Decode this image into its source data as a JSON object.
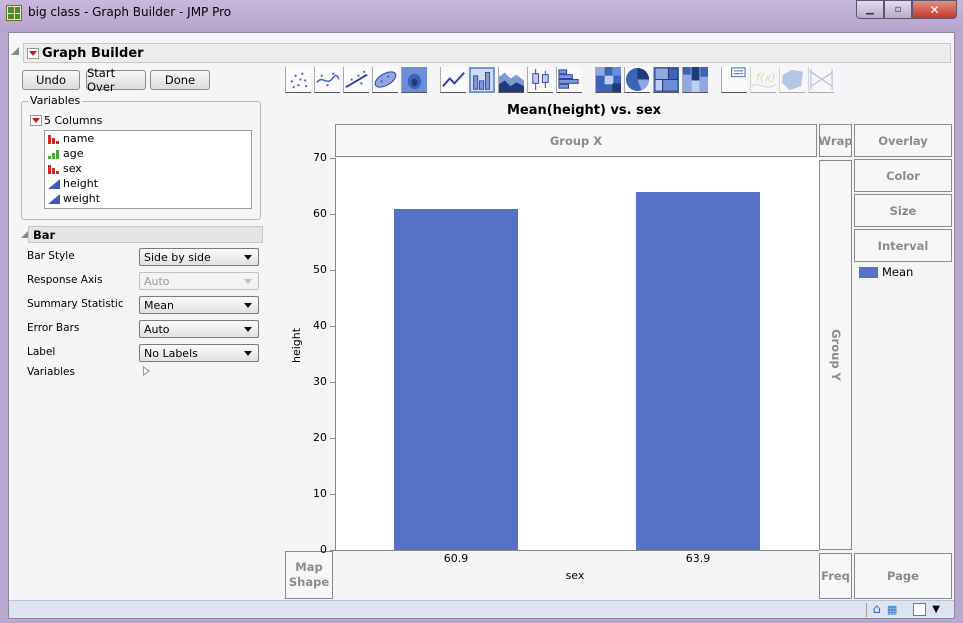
{
  "window": {
    "title": "big class - Graph Builder - JMP Pro",
    "controls": {
      "minimize": "minimize",
      "maximize": "maximize",
      "close": "close"
    }
  },
  "graph_builder": {
    "title": "Graph Builder",
    "buttons": {
      "undo": "Undo",
      "start_over": "Start Over",
      "done": "Done"
    }
  },
  "variables": {
    "legend": "Variables",
    "columns_label": "5 Columns",
    "columns": [
      {
        "name": "name",
        "type": "nominal",
        "icon": "nominal-icon"
      },
      {
        "name": "age",
        "type": "ordinal",
        "icon": "ordinal-icon"
      },
      {
        "name": "sex",
        "type": "nominal",
        "icon": "nominal-icon"
      },
      {
        "name": "height",
        "type": "continuous",
        "icon": "continuous-icon"
      },
      {
        "name": "weight",
        "type": "continuous",
        "icon": "continuous-icon"
      }
    ]
  },
  "bar_panel": {
    "title": "Bar",
    "properties": [
      {
        "label": "Bar Style",
        "value": "Side by side",
        "enabled": true
      },
      {
        "label": "Response Axis",
        "value": "Auto",
        "enabled": false
      },
      {
        "label": "Summary Statistic",
        "value": "Mean",
        "enabled": true
      },
      {
        "label": "Error Bars",
        "value": "Auto",
        "enabled": true
      },
      {
        "label": "Label",
        "value": "No Labels",
        "enabled": true
      }
    ],
    "variables_label": "Variables"
  },
  "toolbar": {
    "elements": [
      "points",
      "smoother",
      "line-of-fit",
      "ellipse",
      "contour",
      "line",
      "bar",
      "area",
      "box-plot",
      "histogram",
      "heatmap",
      "pie",
      "treemap",
      "mosaic",
      "caption-box",
      "formula",
      "map-shapes",
      "parallel"
    ],
    "active": "bar",
    "disabled": [
      "formula",
      "map-shapes",
      "parallel"
    ]
  },
  "zones": {
    "group_x": "Group X",
    "group_y": "Group Y",
    "wrap": "Wrap",
    "overlay": "Overlay",
    "color": "Color",
    "size": "Size",
    "interval": "Interval",
    "map_shape": "Map Shape",
    "freq": "Freq",
    "page": "Page"
  },
  "legend": {
    "items": [
      {
        "label": "Mean",
        "color": "#5572c8"
      }
    ]
  },
  "chart_data": {
    "type": "bar",
    "title": "Mean(height) vs. sex",
    "xlabel": "sex",
    "ylabel": "height",
    "categories": [
      "60.9",
      "63.9"
    ],
    "values": [
      60.9,
      63.9
    ],
    "ylim": [
      0,
      70
    ],
    "yticks": [
      0,
      10,
      20,
      30,
      40,
      50,
      60,
      70
    ],
    "bar_color": "#5572c8",
    "grid": false,
    "legend": "right"
  }
}
